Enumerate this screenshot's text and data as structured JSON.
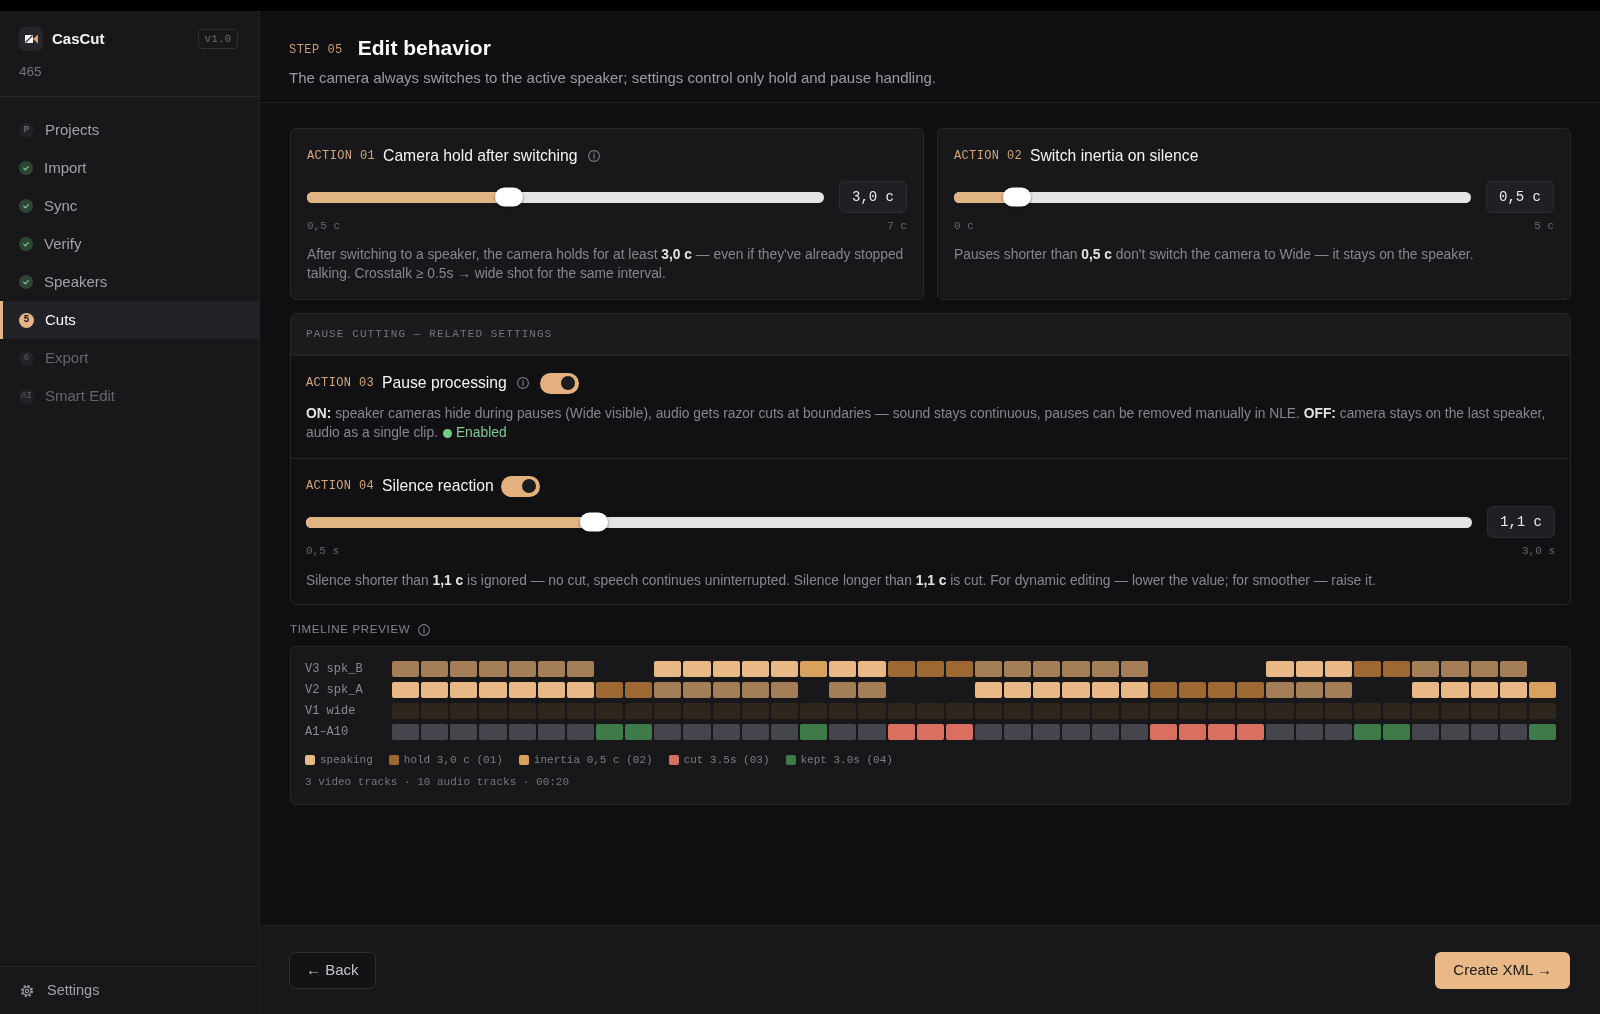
{
  "sidebar": {
    "brand": {
      "name": "CasCut",
      "version": "v1.0",
      "subtitle": "465"
    },
    "items": [
      {
        "label": "Projects",
        "kind": "badge",
        "badge": "P",
        "selected": false,
        "disabled": false
      },
      {
        "label": "Import",
        "kind": "done",
        "selected": false,
        "disabled": false
      },
      {
        "label": "Sync",
        "kind": "done",
        "selected": false,
        "disabled": false
      },
      {
        "label": "Verify",
        "kind": "done",
        "selected": false,
        "disabled": false
      },
      {
        "label": "Speakers",
        "kind": "done",
        "selected": false,
        "disabled": false
      },
      {
        "label": "Cuts",
        "kind": "badge",
        "badge": "5",
        "selected": true,
        "disabled": false
      },
      {
        "label": "Export",
        "kind": "badge",
        "badge": "6",
        "selected": false,
        "disabled": true
      },
      {
        "label": "Smart Edit",
        "kind": "badge",
        "badge": "AI",
        "selected": false,
        "disabled": true
      }
    ],
    "settings": "Settings"
  },
  "header": {
    "step": "STEP 05",
    "title": "Edit behavior",
    "subtitle": "The camera always switches to the active speaker; settings control only hold and pause handling."
  },
  "actions": [
    {
      "kind": "slider",
      "tag": "ACTION 01",
      "title": "Camera hold after switching",
      "info": true,
      "level": 0.385,
      "value": "3,0 c",
      "min": "0,5 c",
      "max": "7 c",
      "description": "After switching to a speaker, the camera holds for at least **3,0 c** — even if they've already stopped talking. Crosstalk ≥ 0.5s → wide shot for the same interval."
    },
    {
      "kind": "slider",
      "tag": "ACTION 02",
      "title": "Switch inertia on silence",
      "info": false,
      "level": 0.1,
      "value": "0,5 c",
      "min": "0 c",
      "max": "5 c",
      "description": "Pauses shorter than **0,5 c** don't switch the camera to Wide — it stays on the speaker."
    }
  ],
  "pause_section": {
    "heading": "PAUSE CUTTING — RELATED SETTINGS",
    "actions": [
      {
        "kind": "toggle",
        "tag": "ACTION 03",
        "title": "Pause processing",
        "info": true,
        "on": true,
        "description": "**ON:** speaker cameras hide during pauses (Wide visible), audio gets razor cuts at boundaries — sound stays continuous, pauses can be removed manually in NLE. **OFF:** camera stays on the last speaker, audio as a single clip.",
        "status": "Enabled"
      },
      {
        "kind": "toggle_slider",
        "tag": "ACTION 04",
        "title": "Silence reaction",
        "info": false,
        "on": true,
        "level": 0.241,
        "value": "1,1 c",
        "min": "0,5 s",
        "max": "3,0 s",
        "description": "Silence shorter than **1,1 c** is ignored — no cut, speech continues uninterrupted. Silence longer than **1,1 c** is cut. For dynamic editing — lower the value; for smoother — raise it."
      }
    ]
  },
  "timeline": {
    "heading": "TIMELINE PREVIEW",
    "info": true,
    "tracks": [
      {
        "label": "V3 spk_B",
        "cells": [
          {
            "kind": "idle"
          },
          {
            "kind": "idle"
          },
          {
            "kind": "idle"
          },
          {
            "kind": "idle"
          },
          {
            "kind": "idle"
          },
          {
            "kind": "idle"
          },
          {
            "kind": "idle"
          },
          {
            "kind": "gap"
          },
          {
            "kind": "gap"
          },
          {
            "kind": "speaking"
          },
          {
            "kind": "speaking"
          },
          {
            "kind": "speaking"
          },
          {
            "kind": "speaking"
          },
          {
            "kind": "speaking"
          },
          {
            "kind": "inertia"
          },
          {
            "kind": "speaking"
          },
          {
            "kind": "speaking"
          },
          {
            "kind": "hold"
          },
          {
            "kind": "hold"
          },
          {
            "kind": "hold"
          },
          {
            "kind": "idle"
          },
          {
            "kind": "idle"
          },
          {
            "kind": "idle"
          },
          {
            "kind": "idle"
          },
          {
            "kind": "idle"
          },
          {
            "kind": "idle"
          },
          {
            "kind": "gap"
          },
          {
            "kind": "gap"
          },
          {
            "kind": "gap"
          },
          {
            "kind": "gap"
          },
          {
            "kind": "speaking"
          },
          {
            "kind": "speaking"
          },
          {
            "kind": "speaking"
          },
          {
            "kind": "hold"
          },
          {
            "kind": "hold"
          },
          {
            "kind": "idle"
          },
          {
            "kind": "idle"
          },
          {
            "kind": "idle"
          },
          {
            "kind": "idle"
          },
          {
            "kind": "gap"
          }
        ]
      },
      {
        "label": "V2 spk_A",
        "cells": [
          {
            "kind": "speaking"
          },
          {
            "kind": "speaking"
          },
          {
            "kind": "speaking"
          },
          {
            "kind": "speaking"
          },
          {
            "kind": "speaking"
          },
          {
            "kind": "speaking"
          },
          {
            "kind": "speaking"
          },
          {
            "kind": "hold"
          },
          {
            "kind": "hold"
          },
          {
            "kind": "idle"
          },
          {
            "kind": "idle"
          },
          {
            "kind": "idle"
          },
          {
            "kind": "idle"
          },
          {
            "kind": "idle"
          },
          {
            "kind": "gap"
          },
          {
            "kind": "idle"
          },
          {
            "kind": "idle"
          },
          {
            "kind": "gap"
          },
          {
            "kind": "gap"
          },
          {
            "kind": "gap"
          },
          {
            "kind": "speaking"
          },
          {
            "kind": "speaking"
          },
          {
            "kind": "speaking"
          },
          {
            "kind": "speaking"
          },
          {
            "kind": "speaking"
          },
          {
            "kind": "speaking"
          },
          {
            "kind": "hold"
          },
          {
            "kind": "hold"
          },
          {
            "kind": "hold"
          },
          {
            "kind": "hold"
          },
          {
            "kind": "idle"
          },
          {
            "kind": "idle"
          },
          {
            "kind": "idle"
          },
          {
            "kind": "gap"
          },
          {
            "kind": "gap"
          },
          {
            "kind": "speaking"
          },
          {
            "kind": "speaking"
          },
          {
            "kind": "speaking"
          },
          {
            "kind": "speaking"
          },
          {
            "kind": "inertia"
          }
        ]
      },
      {
        "label": "V1 wide",
        "cells": [
          {
            "kind": "wide"
          },
          {
            "kind": "wide"
          },
          {
            "kind": "wide"
          },
          {
            "kind": "wide"
          },
          {
            "kind": "wide"
          },
          {
            "kind": "wide"
          },
          {
            "kind": "wide"
          },
          {
            "kind": "wide"
          },
          {
            "kind": "wide"
          },
          {
            "kind": "wide"
          },
          {
            "kind": "wide"
          },
          {
            "kind": "wide"
          },
          {
            "kind": "wide"
          },
          {
            "kind": "wide"
          },
          {
            "kind": "wide"
          },
          {
            "kind": "wide"
          },
          {
            "kind": "wide"
          },
          {
            "kind": "wide"
          },
          {
            "kind": "wide"
          },
          {
            "kind": "wide"
          },
          {
            "kind": "wide"
          },
          {
            "kind": "wide"
          },
          {
            "kind": "wide"
          },
          {
            "kind": "wide"
          },
          {
            "kind": "wide"
          },
          {
            "kind": "wide"
          },
          {
            "kind": "wide"
          },
          {
            "kind": "wide"
          },
          {
            "kind": "wide"
          },
          {
            "kind": "wide"
          },
          {
            "kind": "wide"
          },
          {
            "kind": "wide"
          },
          {
            "kind": "wide"
          },
          {
            "kind": "wide"
          },
          {
            "kind": "wide"
          },
          {
            "kind": "wide"
          },
          {
            "kind": "wide"
          },
          {
            "kind": "wide"
          },
          {
            "kind": "wide"
          },
          {
            "kind": "wide"
          }
        ]
      },
      {
        "label": "A1–A10",
        "cells": [
          {
            "kind": "audio"
          },
          {
            "kind": "audio"
          },
          {
            "kind": "audio"
          },
          {
            "kind": "audio"
          },
          {
            "kind": "audio"
          },
          {
            "kind": "audio"
          },
          {
            "kind": "audio"
          },
          {
            "kind": "kept"
          },
          {
            "kind": "kept"
          },
          {
            "kind": "audio"
          },
          {
            "kind": "audio"
          },
          {
            "kind": "audio"
          },
          {
            "kind": "audio"
          },
          {
            "kind": "audio"
          },
          {
            "kind": "kept"
          },
          {
            "kind": "audio"
          },
          {
            "kind": "audio"
          },
          {
            "kind": "cut"
          },
          {
            "kind": "cut"
          },
          {
            "kind": "cut"
          },
          {
            "kind": "audio"
          },
          {
            "kind": "audio"
          },
          {
            "kind": "audio"
          },
          {
            "kind": "audio"
          },
          {
            "kind": "audio"
          },
          {
            "kind": "audio"
          },
          {
            "kind": "cut"
          },
          {
            "kind": "cut"
          },
          {
            "kind": "cut"
          },
          {
            "kind": "cut"
          },
          {
            "kind": "audio"
          },
          {
            "kind": "audio"
          },
          {
            "kind": "audio"
          },
          {
            "kind": "kept"
          },
          {
            "kind": "kept"
          },
          {
            "kind": "audio"
          },
          {
            "kind": "audio"
          },
          {
            "kind": "audio"
          },
          {
            "kind": "audio"
          },
          {
            "kind": "kept"
          }
        ]
      }
    ],
    "legend": [
      {
        "label": "speaking",
        "color": "#e8b887"
      },
      {
        "label": "hold 3,0 c (01)",
        "color": "#9d6831"
      },
      {
        "label": "inertia 0,5 c (02)",
        "color": "#d8a25e"
      },
      {
        "label": "cut 3.5s (03)",
        "color": "#d9705f"
      },
      {
        "label": "kept 3.0s (04)",
        "color": "#3f7a49"
      }
    ],
    "summary": "3 video tracks · 10 audio tracks · 00:20"
  },
  "footer": {
    "back": "← Back",
    "next": "Create XML →"
  }
}
